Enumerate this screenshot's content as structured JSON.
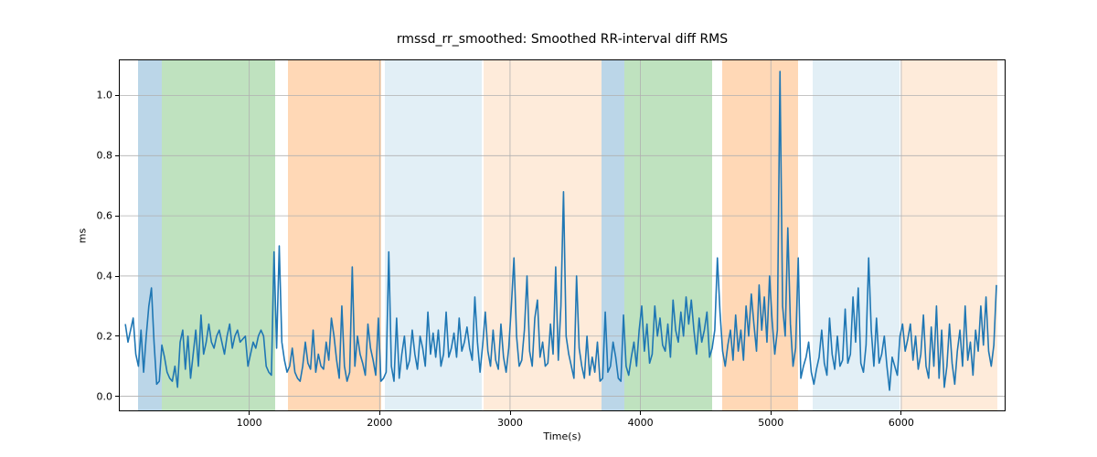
{
  "chart_data": {
    "type": "line",
    "title": "rmssd_rr_smoothed: Smoothed RR-interval diff RMS",
    "xlabel": "Time(s)",
    "ylabel": "ms",
    "xlim": [
      0,
      6800
    ],
    "ylim": [
      -0.05,
      1.12
    ],
    "x_ticks": [
      1000,
      2000,
      3000,
      4000,
      5000,
      6000
    ],
    "y_ticks": [
      0.0,
      0.2,
      0.4,
      0.6,
      0.8,
      1.0
    ],
    "background_bands": [
      {
        "x0": 150,
        "x1": 330,
        "color": "blue"
      },
      {
        "x0": 330,
        "x1": 1200,
        "color": "green"
      },
      {
        "x0": 1300,
        "x1": 2010,
        "color": "orange"
      },
      {
        "x0": 2040,
        "x1": 2780,
        "color": "ltblue"
      },
      {
        "x0": 2800,
        "x1": 3700,
        "color": "peach"
      },
      {
        "x0": 3700,
        "x1": 3880,
        "color": "blue"
      },
      {
        "x0": 3880,
        "x1": 4550,
        "color": "green"
      },
      {
        "x0": 4630,
        "x1": 5210,
        "color": "orange"
      },
      {
        "x0": 5320,
        "x1": 5990,
        "color": "ltblue"
      },
      {
        "x0": 6000,
        "x1": 6740,
        "color": "peach"
      }
    ],
    "series": [
      {
        "name": "rmssd_rr_smoothed",
        "x": [
          50,
          70,
          90,
          110,
          130,
          150,
          170,
          190,
          210,
          230,
          250,
          270,
          290,
          310,
          330,
          350,
          370,
          390,
          410,
          430,
          450,
          470,
          490,
          510,
          530,
          550,
          570,
          590,
          610,
          630,
          650,
          670,
          690,
          710,
          730,
          750,
          770,
          790,
          810,
          830,
          850,
          870,
          890,
          910,
          930,
          950,
          970,
          990,
          1010,
          1030,
          1050,
          1070,
          1090,
          1110,
          1130,
          1150,
          1170,
          1190,
          1210,
          1230,
          1250,
          1270,
          1290,
          1310,
          1330,
          1350,
          1370,
          1390,
          1410,
          1430,
          1450,
          1470,
          1490,
          1510,
          1530,
          1550,
          1570,
          1590,
          1610,
          1630,
          1650,
          1670,
          1690,
          1710,
          1730,
          1750,
          1770,
          1790,
          1810,
          1830,
          1850,
          1870,
          1890,
          1910,
          1930,
          1950,
          1970,
          1990,
          2010,
          2030,
          2050,
          2070,
          2090,
          2110,
          2130,
          2150,
          2170,
          2190,
          2210,
          2230,
          2250,
          2270,
          2290,
          2310,
          2330,
          2350,
          2370,
          2390,
          2410,
          2430,
          2450,
          2470,
          2490,
          2510,
          2530,
          2550,
          2570,
          2590,
          2610,
          2630,
          2650,
          2670,
          2690,
          2710,
          2730,
          2750,
          2770,
          2790,
          2810,
          2830,
          2850,
          2870,
          2890,
          2910,
          2930,
          2950,
          2970,
          2990,
          3010,
          3030,
          3050,
          3070,
          3090,
          3110,
          3130,
          3150,
          3170,
          3190,
          3210,
          3230,
          3250,
          3270,
          3290,
          3310,
          3330,
          3350,
          3370,
          3390,
          3410,
          3430,
          3450,
          3470,
          3490,
          3510,
          3530,
          3550,
          3570,
          3590,
          3610,
          3630,
          3650,
          3670,
          3690,
          3710,
          3730,
          3750,
          3770,
          3790,
          3810,
          3830,
          3850,
          3870,
          3890,
          3910,
          3930,
          3950,
          3970,
          3990,
          4010,
          4030,
          4050,
          4070,
          4090,
          4110,
          4130,
          4150,
          4170,
          4190,
          4210,
          4230,
          4250,
          4270,
          4290,
          4310,
          4330,
          4350,
          4370,
          4390,
          4410,
          4430,
          4450,
          4470,
          4490,
          4510,
          4530,
          4550,
          4570,
          4590,
          4610,
          4630,
          4650,
          4670,
          4690,
          4710,
          4730,
          4750,
          4770,
          4790,
          4810,
          4830,
          4850,
          4870,
          4890,
          4910,
          4930,
          4950,
          4970,
          4990,
          5010,
          5030,
          5050,
          5070,
          5090,
          5110,
          5130,
          5150,
          5170,
          5190,
          5210,
          5230,
          5250,
          5270,
          5290,
          5310,
          5330,
          5350,
          5370,
          5390,
          5410,
          5430,
          5450,
          5470,
          5490,
          5510,
          5530,
          5550,
          5570,
          5590,
          5610,
          5630,
          5650,
          5670,
          5690,
          5710,
          5730,
          5750,
          5770,
          5790,
          5810,
          5830,
          5850,
          5870,
          5890,
          5910,
          5930,
          5950,
          5970,
          5990,
          6010,
          6030,
          6050,
          6070,
          6090,
          6110,
          6130,
          6150,
          6170,
          6190,
          6210,
          6230,
          6250,
          6270,
          6290,
          6310,
          6330,
          6350,
          6370,
          6390,
          6410,
          6430,
          6450,
          6470,
          6490,
          6510,
          6530,
          6550,
          6570,
          6590,
          6610,
          6630,
          6650,
          6670,
          6690,
          6710,
          6730,
          6750
        ],
        "y": [
          0.24,
          0.18,
          0.22,
          0.26,
          0.14,
          0.1,
          0.22,
          0.08,
          0.2,
          0.3,
          0.36,
          0.18,
          0.04,
          0.05,
          0.17,
          0.13,
          0.08,
          0.06,
          0.05,
          0.1,
          0.03,
          0.18,
          0.22,
          0.09,
          0.2,
          0.06,
          0.14,
          0.22,
          0.1,
          0.27,
          0.14,
          0.18,
          0.24,
          0.18,
          0.16,
          0.2,
          0.22,
          0.18,
          0.14,
          0.2,
          0.24,
          0.16,
          0.2,
          0.22,
          0.18,
          0.19,
          0.2,
          0.1,
          0.14,
          0.18,
          0.16,
          0.2,
          0.22,
          0.2,
          0.1,
          0.08,
          0.07,
          0.48,
          0.16,
          0.5,
          0.18,
          0.12,
          0.08,
          0.1,
          0.16,
          0.08,
          0.06,
          0.05,
          0.1,
          0.18,
          0.11,
          0.09,
          0.22,
          0.08,
          0.14,
          0.1,
          0.09,
          0.18,
          0.12,
          0.26,
          0.2,
          0.12,
          0.06,
          0.3,
          0.1,
          0.05,
          0.08,
          0.43,
          0.1,
          0.2,
          0.14,
          0.11,
          0.07,
          0.24,
          0.16,
          0.12,
          0.07,
          0.26,
          0.05,
          0.06,
          0.08,
          0.48,
          0.1,
          0.05,
          0.26,
          0.06,
          0.14,
          0.2,
          0.09,
          0.12,
          0.22,
          0.14,
          0.09,
          0.2,
          0.16,
          0.1,
          0.28,
          0.14,
          0.21,
          0.13,
          0.22,
          0.1,
          0.14,
          0.28,
          0.13,
          0.16,
          0.21,
          0.13,
          0.26,
          0.15,
          0.18,
          0.23,
          0.16,
          0.12,
          0.33,
          0.18,
          0.08,
          0.17,
          0.28,
          0.15,
          0.1,
          0.22,
          0.12,
          0.09,
          0.24,
          0.13,
          0.08,
          0.16,
          0.3,
          0.46,
          0.2,
          0.1,
          0.12,
          0.22,
          0.4,
          0.15,
          0.1,
          0.26,
          0.32,
          0.13,
          0.18,
          0.1,
          0.11,
          0.24,
          0.14,
          0.43,
          0.12,
          0.3,
          0.68,
          0.2,
          0.14,
          0.1,
          0.06,
          0.4,
          0.16,
          0.1,
          0.06,
          0.2,
          0.07,
          0.13,
          0.08,
          0.18,
          0.05,
          0.06,
          0.28,
          0.08,
          0.1,
          0.18,
          0.13,
          0.06,
          0.05,
          0.27,
          0.1,
          0.07,
          0.13,
          0.18,
          0.1,
          0.22,
          0.3,
          0.15,
          0.24,
          0.11,
          0.14,
          0.3,
          0.2,
          0.26,
          0.17,
          0.15,
          0.24,
          0.13,
          0.32,
          0.22,
          0.18,
          0.28,
          0.2,
          0.33,
          0.24,
          0.32,
          0.22,
          0.14,
          0.26,
          0.18,
          0.22,
          0.28,
          0.13,
          0.16,
          0.22,
          0.46,
          0.28,
          0.15,
          0.1,
          0.17,
          0.22,
          0.12,
          0.27,
          0.15,
          0.22,
          0.12,
          0.3,
          0.2,
          0.34,
          0.24,
          0.15,
          0.37,
          0.22,
          0.33,
          0.18,
          0.4,
          0.25,
          0.14,
          0.22,
          1.08,
          0.3,
          0.2,
          0.56,
          0.24,
          0.1,
          0.16,
          0.46,
          0.06,
          0.1,
          0.13,
          0.18,
          0.08,
          0.04,
          0.09,
          0.13,
          0.22,
          0.11,
          0.07,
          0.26,
          0.14,
          0.09,
          0.2,
          0.1,
          0.12,
          0.29,
          0.11,
          0.14,
          0.33,
          0.18,
          0.36,
          0.11,
          0.08,
          0.17,
          0.46,
          0.22,
          0.1,
          0.26,
          0.11,
          0.14,
          0.2,
          0.1,
          0.02,
          0.13,
          0.1,
          0.07,
          0.2,
          0.24,
          0.15,
          0.19,
          0.24,
          0.12,
          0.2,
          0.09,
          0.14,
          0.27,
          0.1,
          0.06,
          0.23,
          0.1,
          0.3,
          0.06,
          0.22,
          0.03,
          0.1,
          0.24,
          0.11,
          0.04,
          0.15,
          0.22,
          0.1,
          0.3,
          0.12,
          0.18,
          0.07,
          0.22,
          0.15,
          0.3,
          0.17,
          0.33,
          0.15,
          0.1,
          0.17,
          0.37
        ]
      }
    ]
  }
}
